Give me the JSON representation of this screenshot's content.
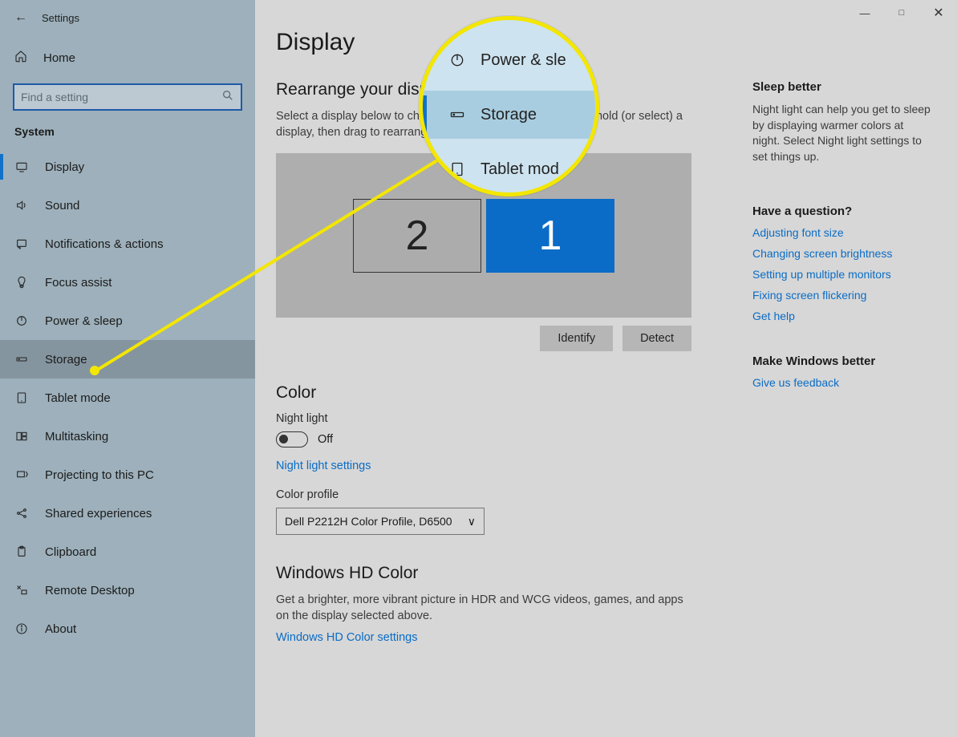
{
  "window": {
    "title": "Settings"
  },
  "sidebar": {
    "home": "Home",
    "search_placeholder": "Find a setting",
    "section": "System",
    "items": [
      {
        "label": "Display"
      },
      {
        "label": "Sound"
      },
      {
        "label": "Notifications & actions"
      },
      {
        "label": "Focus assist"
      },
      {
        "label": "Power & sleep"
      },
      {
        "label": "Storage"
      },
      {
        "label": "Tablet mode"
      },
      {
        "label": "Multitasking"
      },
      {
        "label": "Projecting to this PC"
      },
      {
        "label": "Shared experiences"
      },
      {
        "label": "Clipboard"
      },
      {
        "label": "Remote Desktop"
      },
      {
        "label": "About"
      }
    ]
  },
  "main": {
    "title": "Display",
    "rearrange_heading": "Rearrange your displays",
    "rearrange_desc": "Select a display below to change the settings for it. Press and hold (or select) a display, then drag to rearrange it.",
    "monitor1": "1",
    "monitor2": "2",
    "identify": "Identify",
    "detect": "Detect",
    "color_heading": "Color",
    "night_light_label": "Night light",
    "toggle_state": "Off",
    "night_light_link": "Night light settings",
    "color_profile_label": "Color profile",
    "color_profile_value": "Dell P2212H Color Profile, D6500",
    "hd_heading": "Windows HD Color",
    "hd_desc": "Get a brighter, more vibrant picture in HDR and WCG videos, games, and apps on the display selected above.",
    "hd_link": "Windows HD Color settings"
  },
  "right": {
    "sleep_title": "Sleep better",
    "sleep_body": "Night light can help you get to sleep by displaying warmer colors at night. Select Night light settings to set things up.",
    "question_title": "Have a question?",
    "links": [
      "Adjusting font size",
      "Changing screen brightness",
      "Setting up multiple monitors",
      "Fixing screen flickering",
      "Get help"
    ],
    "feedback_title": "Make Windows better",
    "feedback_link": "Give us feedback"
  },
  "callout": {
    "row1": "Power & sle",
    "row2": "Storage",
    "row3": "Tablet mod"
  }
}
